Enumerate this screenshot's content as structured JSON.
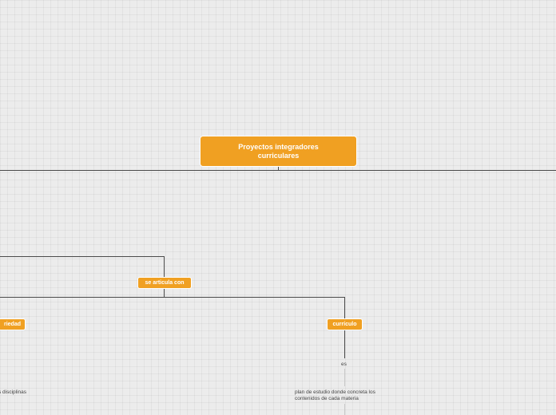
{
  "map": {
    "root": "Proyectos integradores curriculares",
    "articula": "se articula con",
    "edad": "riedad",
    "curriculo": "currículo",
    "es": "es",
    "plan_line1": "plan de estudio donde concreta los",
    "plan_line2": "contenidos de cada materia",
    "disciplinas": "s disciplinas"
  },
  "colors": {
    "topic": "#f0a022",
    "connector": "#4a4a4a",
    "background": "#ececec"
  }
}
